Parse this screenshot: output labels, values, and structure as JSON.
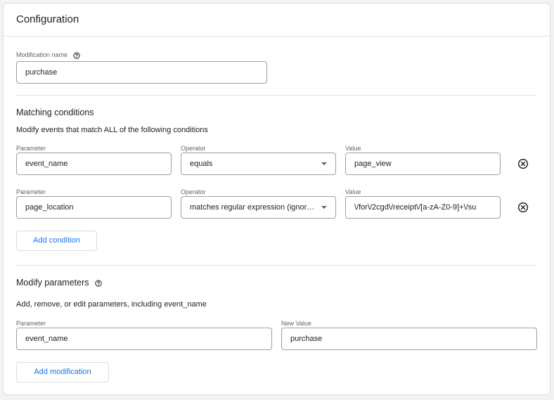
{
  "header": {
    "title": "Configuration"
  },
  "modification": {
    "label": "Modification name",
    "value": "purchase"
  },
  "matching": {
    "title": "Matching conditions",
    "description": "Modify events that match ALL of the following conditions",
    "conditions": [
      {
        "parameter_label": "Parameter",
        "parameter": "event_name",
        "operator_label": "Operator",
        "operator": "equals",
        "value_label": "Value",
        "value": "page_view"
      },
      {
        "parameter_label": "Parameter",
        "parameter": "page_location",
        "operator_label": "Operator",
        "operator": "matches regular expression (ignor…",
        "value_label": "Value",
        "value": "\\/for\\/2cgd\\/receipt\\/[a-zA-Z0-9]+\\/su"
      }
    ],
    "add_condition_label": "Add condition"
  },
  "modify_params": {
    "title": "Modify parameters",
    "description": "Add, remove, or edit parameters, including event_name",
    "rows": [
      {
        "parameter_label": "Parameter",
        "parameter": "event_name",
        "new_value_label": "New Value",
        "new_value": "purchase"
      }
    ],
    "add_modification_label": "Add modification"
  },
  "colors": {
    "accent": "#1a73e8",
    "border": "#9aa0a6",
    "divider": "#e0e0e0",
    "label": "#5f6368"
  },
  "icons": {
    "help": "help-circle-icon",
    "remove": "remove-circle-icon",
    "dropdown": "dropdown-caret-icon"
  }
}
